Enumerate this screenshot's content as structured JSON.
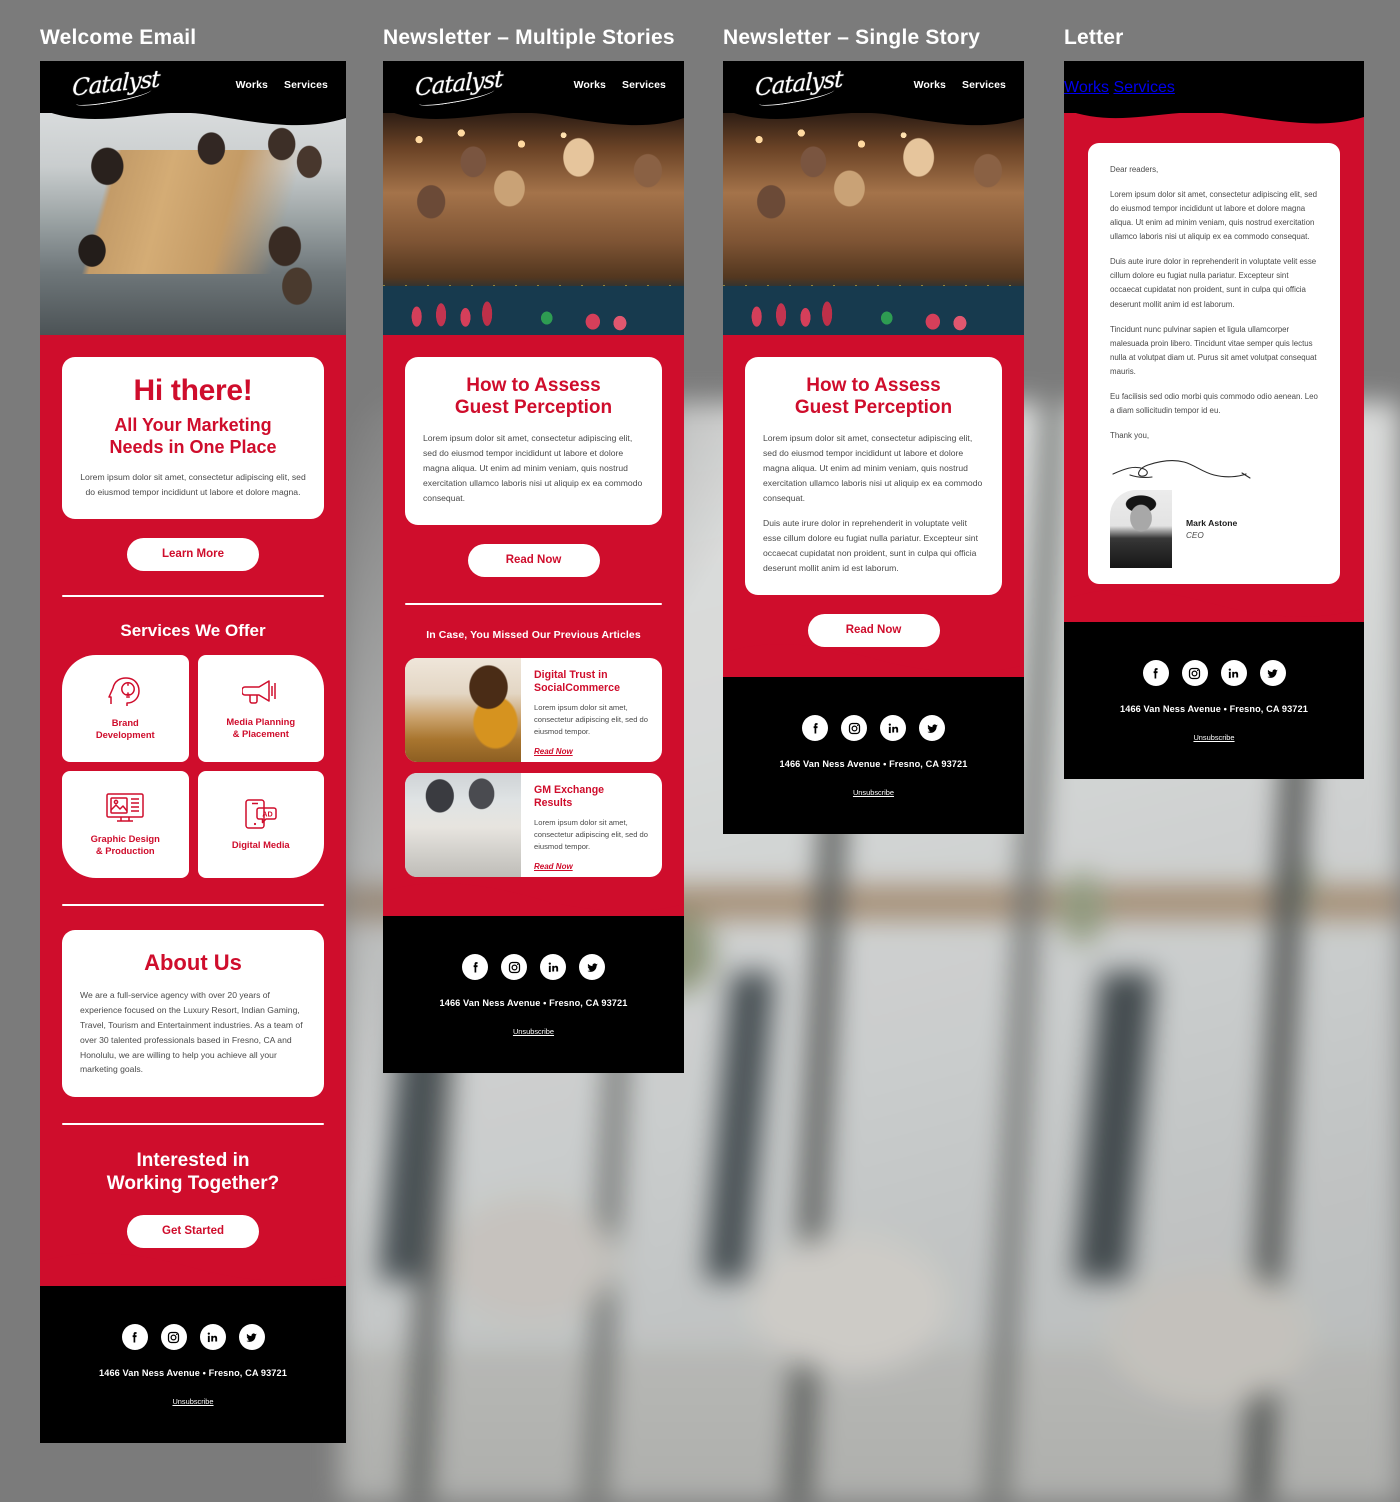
{
  "brand": {
    "logo_text": "Catalyst",
    "accent_red": "#CF0D2C",
    "black": "#000000",
    "white": "#FFFFFF"
  },
  "nav": {
    "works": "Works",
    "services": "Services"
  },
  "columns": [
    {
      "title": "Welcome Email"
    },
    {
      "title": "Newsletter – Multiple Stories"
    },
    {
      "title": "Newsletter – Single Story"
    },
    {
      "title": "Letter"
    }
  ],
  "welcome": {
    "hero_image_alt": "office-team-meeting-photo",
    "headline": "Hi there!",
    "subheadline_line1": "All Your Marketing",
    "subheadline_line2": "Needs in One Place",
    "intro_body": "Lorem ipsum dolor sit amet, consectetur adipiscing elit, sed do eiusmod tempor incididunt ut labore et dolore magna.",
    "cta_label": "Learn More",
    "services_title": "Services We Offer",
    "services": [
      {
        "icon": "head-lightbulb-icon",
        "label_line1": "Brand",
        "label_line2": "Development"
      },
      {
        "icon": "megaphone-icon",
        "label_line1": "Media Planning",
        "label_line2": "& Placement"
      },
      {
        "icon": "monitor-design-icon",
        "label_line1": "Graphic Design",
        "label_line2": "& Production"
      },
      {
        "icon": "mobile-ad-icon",
        "label_line1": "Digital Media",
        "label_line2": ""
      }
    ],
    "about_title": "About Us",
    "about_body": "We are a full-service agency with over 20 years of experience focused on the Luxury Resort, Indian Gaming, Travel, Tourism and Entertainment industries. As a team of over 30 talented professionals based in Fresno, CA and Honolulu, we are willing to help you achieve all your marketing goals.",
    "cta2_line1": "Interested in",
    "cta2_line2": "Working Together?",
    "cta2_label": "Get Started"
  },
  "newsletter_multi": {
    "hero_image_alt": "casino-roulette-table-photo",
    "story_title_line1": "How to Assess",
    "story_title_line2": "Guest Perception",
    "story_body": "Lorem ipsum dolor sit amet, consectetur adipiscing elit, sed do eiusmod tempor incididunt ut labore et dolore magna aliqua. Ut enim ad minim veniam, quis nostrud exercitation ullamco laboris nisi ut aliquip ex ea commodo consequat.",
    "cta_label": "Read Now",
    "previous_title": "In Case, You Missed Our Previous Articles",
    "articles": [
      {
        "image_alt": "woman-at-laptop-photo",
        "title_line1": "Digital Trust in",
        "title_line2": "SocialCommerce",
        "body": "Lorem ipsum dolor sit amet, consectetur adipiscing elit, sed do eiusmod tempor.",
        "link_label": "Read Now"
      },
      {
        "image_alt": "desk-charts-meeting-photo",
        "title_line1": "GM Exchange",
        "title_line2": "Results",
        "body": "Lorem ipsum dolor sit amet, consectetur adipiscing elit, sed do eiusmod tempor.",
        "link_label": "Read Now"
      }
    ]
  },
  "newsletter_single": {
    "hero_image_alt": "casino-roulette-table-photo",
    "story_title_line1": "How to Assess",
    "story_title_line2": "Guest Perception",
    "story_body_p1": "Lorem ipsum dolor sit amet, consectetur adipiscing elit, sed do eiusmod tempor incididunt ut labore et dolore magna aliqua. Ut enim ad minim veniam, quis nostrud exercitation ullamco laboris nisi ut aliquip ex ea commodo consequat.",
    "story_body_p2": "Duis aute irure dolor in reprehenderit in voluptate velit esse cillum dolore eu fugiat nulla pariatur. Excepteur sint occaecat cupidatat non proident, sunt in culpa qui officia deserunt mollit anim id est laborum.",
    "cta_label": "Read Now"
  },
  "letter": {
    "salutation": "Dear readers,",
    "p1": "Lorem ipsum dolor sit amet, consectetur adipiscing elit, sed do eiusmod tempor incididunt ut labore et dolore magna aliqua. Ut enim ad minim veniam, quis nostrud exercitation ullamco laboris nisi ut aliquip ex ea commodo consequat.",
    "p2": "Duis aute irure dolor in reprehenderit in voluptate velit esse cillum dolore eu fugiat nulla pariatur. Excepteur sint occaecat cupidatat non proident, sunt in culpa qui officia deserunt mollit anim id est laborum.",
    "p3": "Tincidunt nunc pulvinar sapien et ligula ullamcorper malesuada proin libero. Tincidunt vitae semper quis lectus nulla at volutpat diam ut. Purus sit amet volutpat consequat mauris.",
    "p4": "Eu facilisis sed odio morbi quis commodo odio aenean. Leo a diam sollicitudin tempor id eu.",
    "closing": "Thank you,",
    "signature_alt": "handwritten-signature",
    "headshot_alt": "mark-astone-headshot",
    "signer_name": "Mark Astone",
    "signer_role": "CEO"
  },
  "footer": {
    "socials": [
      {
        "icon": "facebook-icon",
        "name": "Facebook"
      },
      {
        "icon": "instagram-icon",
        "name": "Instagram"
      },
      {
        "icon": "linkedin-icon",
        "name": "LinkedIn"
      },
      {
        "icon": "twitter-icon",
        "name": "Twitter"
      }
    ],
    "address": "1466 Van Ness Avenue   •   Fresno, CA 93721",
    "unsubscribe": "Unsubscribe"
  }
}
